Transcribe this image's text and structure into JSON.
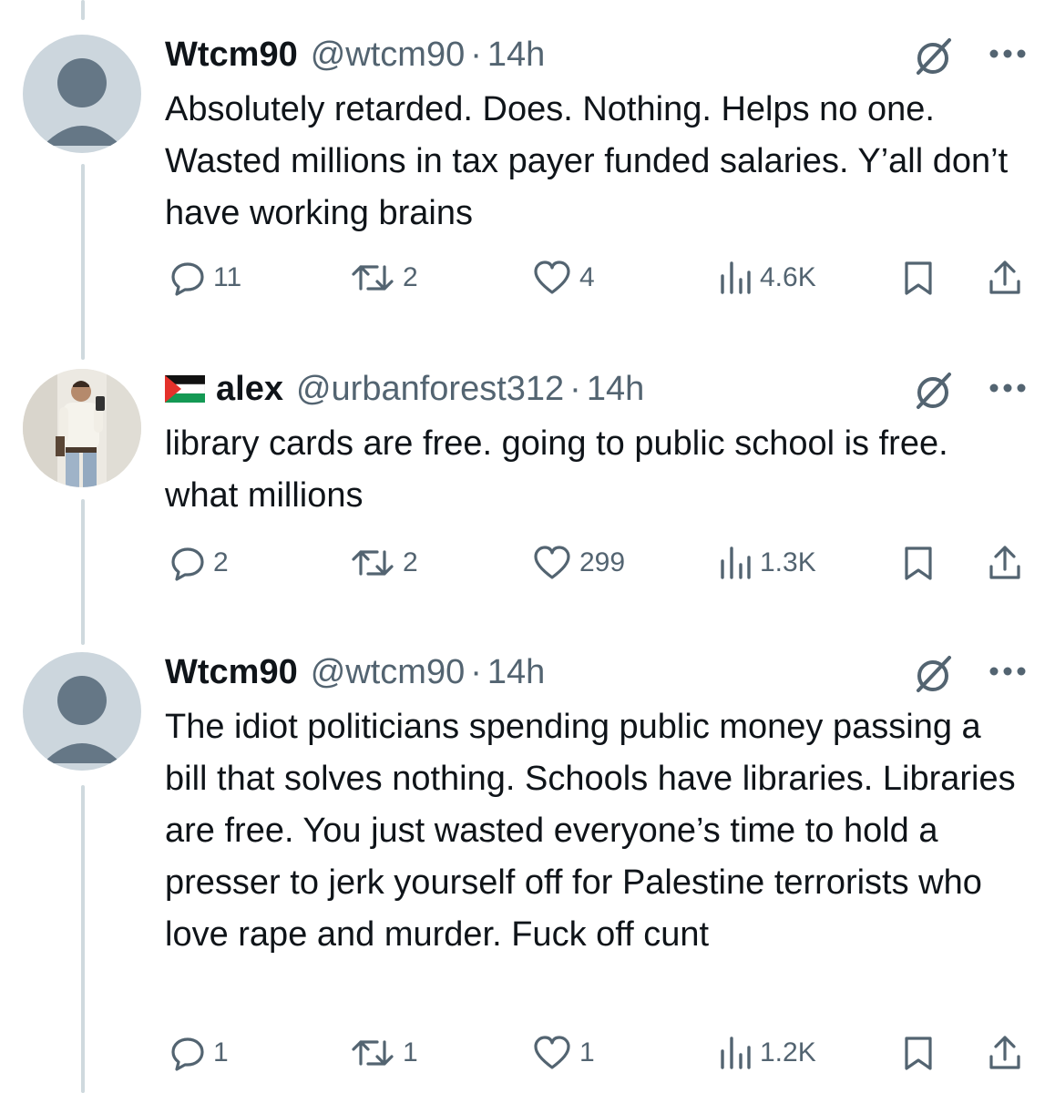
{
  "tweets": [
    {
      "display_name": "Wtcm90",
      "handle": "@wtcm90",
      "separator": "·",
      "time": "14h",
      "has_flag": false,
      "text": "Absolutely retarded.  Does. Nothing. Helps no one. Wasted millions in tax payer funded salaries. Y’all don’t have working brains",
      "replies": "11",
      "reposts": "2",
      "likes": "4",
      "views": "4.6K"
    },
    {
      "display_name": "alex",
      "handle": "@urbanforest312",
      "separator": "·",
      "time": "14h",
      "has_flag": true,
      "text": "library cards are free. going to public school is free. what millions",
      "replies": "2",
      "reposts": "2",
      "likes": "299",
      "views": "1.3K"
    },
    {
      "display_name": "Wtcm90",
      "handle": "@wtcm90",
      "separator": "·",
      "time": "14h",
      "has_flag": false,
      "text": "The idiot politicians spending public money passing a bill that solves nothing. Schools have libraries. Libraries are free. You just wasted everyone’s time to hold a presser to jerk yourself off for Palestine terrorists who love rape and murder. Fuck off cunt",
      "replies": "1",
      "reposts": "1",
      "likes": "1",
      "views": "1.2K"
    }
  ],
  "icons": {
    "reply": "reply-icon",
    "repost": "repost-icon",
    "like": "heart-icon",
    "views": "views-icon",
    "bookmark": "bookmark-icon",
    "share": "share-icon",
    "grok": "grok-icon",
    "more": "more-icon",
    "flag": "palestine-flag-icon"
  },
  "colors": {
    "text": "#0f1419",
    "secondary": "#536471",
    "thread_line": "#cfd9de",
    "avatar_default": "#ccd6dd",
    "avatar_silhouette": "#657786"
  }
}
